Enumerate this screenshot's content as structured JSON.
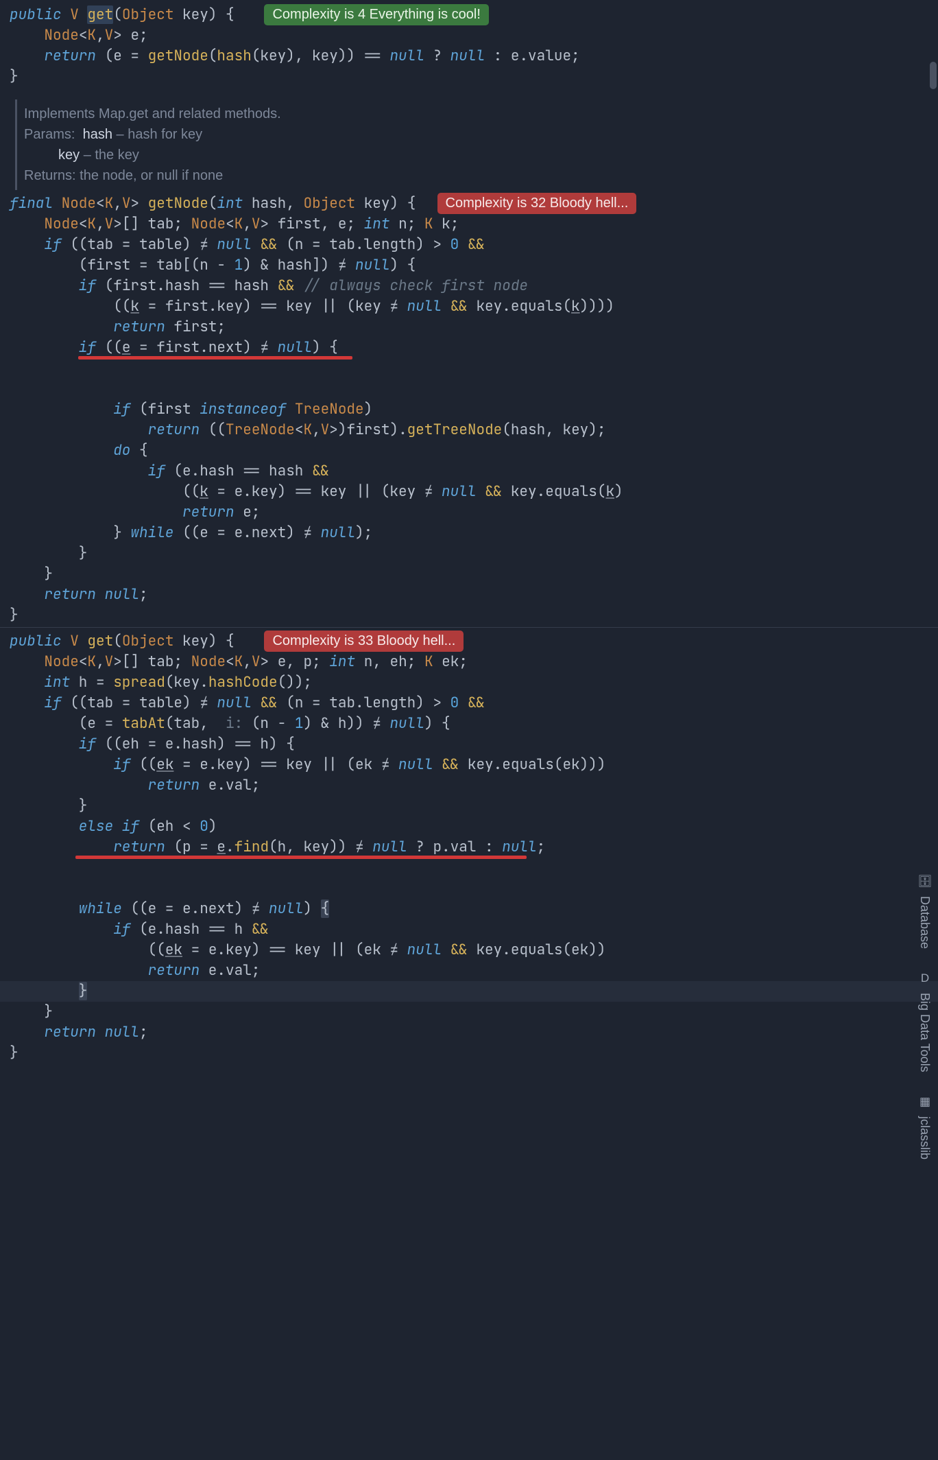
{
  "badges": {
    "good": "Complexity is 4 Everything is cool!",
    "bad32": "Complexity is 32 Bloody hell...",
    "bad33": "Complexity is 33 Bloody hell..."
  },
  "doc": {
    "summary": "Implements Map.get and related methods.",
    "params_label": "Params:",
    "p1_name": "hash",
    "p1_desc": " – hash for key",
    "p2_name": "key",
    "p2_desc": " – the key",
    "returns_label": "Returns:",
    "returns_desc": " the node, or null if none"
  },
  "code1": {
    "l1_a": "public",
    "l1_b": " V ",
    "l1_c": "get",
    "l1_d": "(",
    "l1_e": "Object",
    "l1_f": " key) {",
    "l2": "    Node<K,V> e;",
    "l3_a": "    return",
    "l3_b": " (e = ",
    "l3_c": "getNode",
    "l3_d": "(",
    "l3_e": "hash",
    "l3_f": "(key), key)) == ",
    "l3_g": "null",
    "l3_h": " ? ",
    "l3_i": "null",
    "l3_j": " : e.value;",
    "l4": "}"
  },
  "code2": {
    "l1_a": "final",
    "l1_b": " Node<K,V> ",
    "l1_c": "getNode",
    "l1_d": "(",
    "l1_e": "int",
    "l1_f": " hash, ",
    "l1_g": "Object",
    "l1_h": " key) {",
    "l2_a": "    Node<K,V>[] tab; Node<K,V> first, e; ",
    "l2_b": "int",
    "l2_c": " n; K k;",
    "l3_a": "    if",
    "l3_b": " ((tab = table) ≠ ",
    "l3_c": "null",
    "l3_d": " && (n = tab.length) > 0 &&",
    "l4": "        (first = tab[(n - 1) & hash]) ≠ null) {",
    "l5_a": "        if",
    "l5_b": " (first.hash == hash && ",
    "l5_c": "// always check first node",
    "l6": "            ((k = first.key) == key || (key ≠ null && key.equals(k))))",
    "l7_a": "            return",
    "l7_b": " first;",
    "l8_a": "        if",
    "l8_b": " ((e = first.next) ≠ ",
    "l8_c": "null",
    "l8_d": ") {",
    "l9_a": "            if",
    "l9_b": " (first ",
    "l9_c": "instanceof",
    "l9_d": " TreeNode)",
    "l10_a": "                return",
    "l10_b": " ((TreeNode<K,V>)first).",
    "l10_c": "getTreeNode",
    "l10_d": "(hash, key);",
    "l11_a": "            do",
    "l11_b": " {",
    "l12_a": "                if",
    "l12_b": " (e.hash == hash &&",
    "l13": "                    ((k = e.key) == key || (key ≠ null && key.equals(k)",
    "l14_a": "                    return",
    "l14_b": " e;",
    "l15_a": "            } ",
    "l15_b": "while",
    "l15_c": " ((e = e.next) ≠ ",
    "l15_d": "null",
    "l15_e": ");",
    "l16": "        }",
    "l17": "    }",
    "l18_a": "    return",
    "l18_b": " null",
    "l18_c": ";",
    "l19": "}"
  },
  "code3": {
    "l1_a": "public",
    "l1_b": " V ",
    "l1_c": "get",
    "l1_d": "(",
    "l1_e": "Object",
    "l1_f": " key) {",
    "l2_a": "    Node<K,V>[] tab; Node<K,V> e, p; ",
    "l2_b": "int",
    "l2_c": " n, eh; K ek;",
    "l3_a": "    int",
    "l3_b": " h = ",
    "l3_c": "spread",
    "l3_d": "(key.",
    "l3_e": "hashCode",
    "l3_f": "());",
    "l4_a": "    if",
    "l4_b": " ((tab = table) ≠ ",
    "l4_c": "null",
    "l4_d": " && (n = tab.length) > 0 &&",
    "l5_a": "        (e = ",
    "l5_b": "tabAt",
    "l5_c": "(tab,  i: (n - 1) & h)) ≠ ",
    "l5_d": "null",
    "l5_e": ") {",
    "l6_a": "        if",
    "l6_b": " ((eh = e.hash) == h) {",
    "l7_a": "            if",
    "l7_b": " ((ek = e.key) == key || (ek ≠ ",
    "l7_c": "null",
    "l7_d": " && key.equals(ek)))",
    "l8_a": "                return",
    "l8_b": " e.val;",
    "l9": "        }",
    "l10_a": "        else if",
    "l10_b": " (eh < 0)",
    "l11_a": "            return",
    "l11_b": " (p = e.",
    "l11_c": "find",
    "l11_d": "(h, key)) ≠ ",
    "l11_e": "null",
    "l11_f": " ? p.val : ",
    "l11_g": "null",
    "l11_h": ";",
    "l12_a": "        while",
    "l12_b": " ((e = e.next) ≠ ",
    "l12_c": "null",
    "l12_d": ") {",
    "l13_a": "            if",
    "l13_b": " (e.hash == h &&",
    "l14": "                ((ek = e.key) == key || (ek ≠ null && key.equals(ek))",
    "l15_a": "                return",
    "l15_b": " e.val;",
    "l16": "        }",
    "l17": "    }",
    "l18_a": "    return",
    "l18_b": " null",
    "l18_c": ";",
    "l19": "}"
  },
  "rightTabs": {
    "t1": "Database",
    "t2": "Big Data Tools",
    "t3": "jclasslib"
  }
}
